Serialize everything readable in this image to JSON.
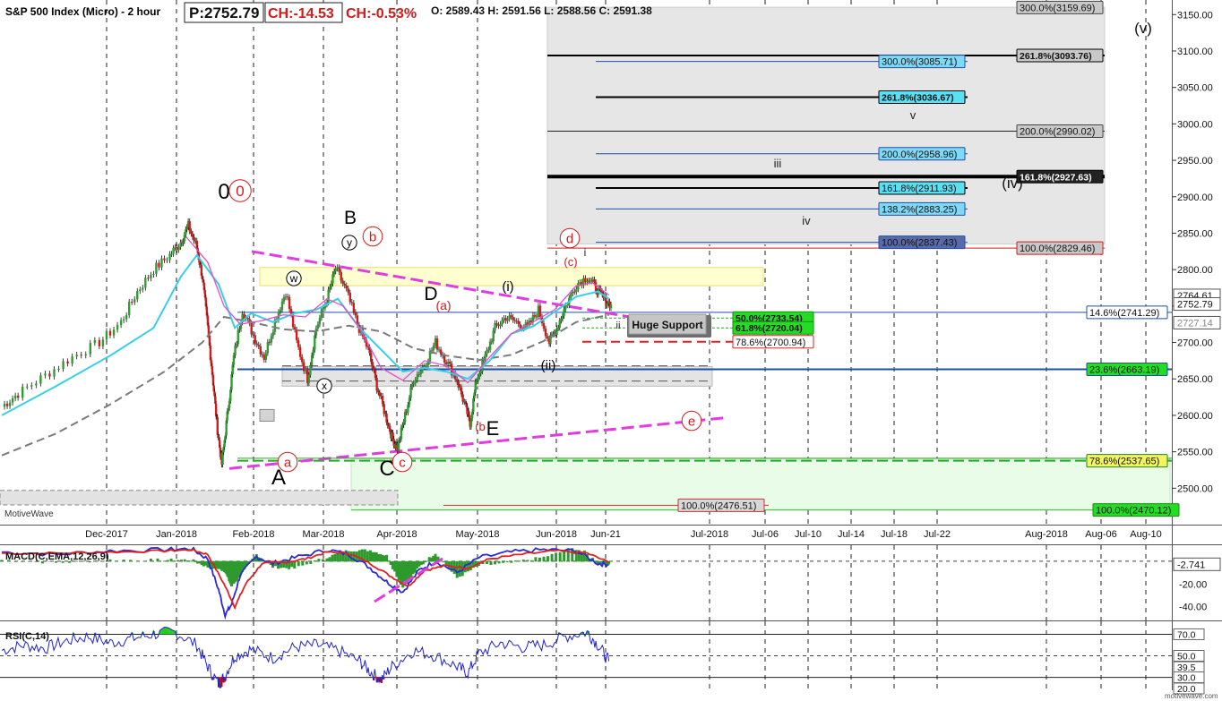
{
  "header": {
    "title": "S&P 500 Index (Micro) - 2 hour",
    "price": "P:2752.79",
    "change": "CH:-14.53",
    "change_pct": "CH:-0.53%",
    "ohlc": "O: 2589.43  H: 2591.56  L: 2588.56  C: 2591.38"
  },
  "watermark": "MotiveWave",
  "footer_site": "motivewave.com",
  "colors": {
    "up": "#2e9e2e",
    "down": "#d21c1c",
    "ma_fast": "#e050c8",
    "ma_mid": "#37cfe8",
    "ma_slow": "#7a7a7a",
    "trendline": "#e03ce0",
    "wave_red": "#d21c1c",
    "fib_blue": "#1d4fa8",
    "macd": "#2a2ad8",
    "signal": "#e22020",
    "hist": "#2e9a2e",
    "rsi": "#2222cc"
  },
  "chart_data": [
    {
      "type": "line",
      "panel": "price",
      "y_axis": {
        "min": 2450,
        "max": 3170,
        "ticks": [
          2500,
          2550,
          2600,
          2650,
          2700,
          2750,
          2800,
          2850,
          2900,
          2950,
          3000,
          3050,
          3100,
          3150
        ],
        "tick_labels": [
          "2500.00",
          "2550.00",
          "2600.00",
          "2650.00",
          "2700.00",
          "2750.00",
          "2800.00",
          "2850.00",
          "2900.00",
          "2950.00",
          "3000.00",
          "3050.00",
          "3100.00",
          "3150.00"
        ]
      },
      "x_axis": {
        "labels": [
          "Dec-2017",
          "Jan-2018",
          "Feb-2018",
          "Mar-2018",
          "Apr-2018",
          "May-2018",
          "Jun-2018",
          "Jun-21",
          "Jul-2018",
          "Jul-06",
          "Jul-10",
          "Jul-14",
          "Jul-18",
          "Jul-22",
          "Aug-2018",
          "Aug-06",
          "Aug-10"
        ]
      },
      "price_path": [
        [
          0,
          2612
        ],
        [
          0.015,
          2630
        ],
        [
          0.04,
          2655
        ],
        [
          0.065,
          2680
        ],
        [
          0.09,
          2700
        ],
        [
          0.11,
          2728
        ],
        [
          0.125,
          2770
        ],
        [
          0.14,
          2800
        ],
        [
          0.155,
          2820
        ],
        [
          0.165,
          2838
        ],
        [
          0.172,
          2860
        ],
        [
          0.18,
          2830
        ],
        [
          0.185,
          2790
        ],
        [
          0.19,
          2720
        ],
        [
          0.195,
          2645
        ],
        [
          0.199,
          2580
        ],
        [
          0.203,
          2533
        ],
        [
          0.208,
          2600
        ],
        [
          0.214,
          2680
        ],
        [
          0.222,
          2745
        ],
        [
          0.232,
          2710
        ],
        [
          0.242,
          2680
        ],
        [
          0.252,
          2730
        ],
        [
          0.262,
          2770
        ],
        [
          0.272,
          2700
        ],
        [
          0.282,
          2650
        ],
        [
          0.29,
          2720
        ],
        [
          0.3,
          2760
        ],
        [
          0.308,
          2802
        ],
        [
          0.318,
          2770
        ],
        [
          0.328,
          2725
        ],
        [
          0.338,
          2690
        ],
        [
          0.346,
          2640
        ],
        [
          0.354,
          2600
        ],
        [
          0.36,
          2570
        ],
        [
          0.365,
          2555
        ],
        [
          0.372,
          2600
        ],
        [
          0.38,
          2650
        ],
        [
          0.39,
          2670
        ],
        [
          0.4,
          2700
        ],
        [
          0.41,
          2675
        ],
        [
          0.42,
          2648
        ],
        [
          0.428,
          2610
        ],
        [
          0.432,
          2590
        ],
        [
          0.438,
          2650
        ],
        [
          0.446,
          2680
        ],
        [
          0.455,
          2720
        ],
        [
          0.465,
          2735
        ],
        [
          0.475,
          2728
        ],
        [
          0.485,
          2720
        ],
        [
          0.495,
          2745
        ],
        [
          0.505,
          2700
        ],
        [
          0.512,
          2720
        ],
        [
          0.52,
          2750
        ],
        [
          0.53,
          2780
        ],
        [
          0.54,
          2790
        ],
        [
          0.548,
          2775
        ],
        [
          0.555,
          2760
        ],
        [
          0.562,
          2752
        ]
      ],
      "ma_fast": [
        [
          0.17,
          2845
        ],
        [
          0.19,
          2810
        ],
        [
          0.205,
          2750
        ],
        [
          0.22,
          2725
        ],
        [
          0.24,
          2730
        ],
        [
          0.26,
          2738
        ],
        [
          0.28,
          2735
        ],
        [
          0.3,
          2760
        ],
        [
          0.315,
          2750
        ],
        [
          0.33,
          2720
        ],
        [
          0.35,
          2665
        ],
        [
          0.37,
          2648
        ],
        [
          0.39,
          2675
        ],
        [
          0.41,
          2668
        ],
        [
          0.43,
          2645
        ],
        [
          0.45,
          2680
        ],
        [
          0.47,
          2712
        ],
        [
          0.49,
          2728
        ],
        [
          0.51,
          2745
        ],
        [
          0.53,
          2778
        ],
        [
          0.545,
          2782
        ],
        [
          0.56,
          2765
        ]
      ],
      "ma_mid": [
        [
          0.0,
          2600
        ],
        [
          0.05,
          2640
        ],
        [
          0.1,
          2682
        ],
        [
          0.14,
          2720
        ],
        [
          0.165,
          2790
        ],
        [
          0.18,
          2820
        ],
        [
          0.2,
          2780
        ],
        [
          0.215,
          2720
        ],
        [
          0.23,
          2740
        ],
        [
          0.25,
          2728
        ],
        [
          0.27,
          2740
        ],
        [
          0.29,
          2745
        ],
        [
          0.31,
          2760
        ],
        [
          0.33,
          2720
        ],
        [
          0.35,
          2690
        ],
        [
          0.37,
          2660
        ],
        [
          0.39,
          2665
        ],
        [
          0.41,
          2660
        ],
        [
          0.43,
          2650
        ],
        [
          0.45,
          2675
        ],
        [
          0.47,
          2712
        ],
        [
          0.49,
          2722
        ],
        [
          0.51,
          2742
        ],
        [
          0.53,
          2763
        ],
        [
          0.55,
          2770
        ],
        [
          0.56,
          2760
        ]
      ],
      "ma_slow": [
        [
          0.0,
          2545
        ],
        [
          0.05,
          2575
        ],
        [
          0.1,
          2615
        ],
        [
          0.15,
          2660
        ],
        [
          0.185,
          2700
        ],
        [
          0.205,
          2735
        ],
        [
          0.23,
          2728
        ],
        [
          0.26,
          2718
        ],
        [
          0.29,
          2715
        ],
        [
          0.32,
          2723
        ],
        [
          0.35,
          2715
        ],
        [
          0.38,
          2692
        ],
        [
          0.41,
          2682
        ],
        [
          0.44,
          2676
        ],
        [
          0.47,
          2683
        ],
        [
          0.5,
          2702
        ],
        [
          0.53,
          2728
        ],
        [
          0.56,
          2738
        ]
      ],
      "fib_levels": [
        {
          "label": "300.0%(3159.69)",
          "value": 3159.69,
          "style": "gray"
        },
        {
          "label": "261.8%(3093.76)",
          "value": 3093.76,
          "style": "gray-bold"
        },
        {
          "label": "300.0%(3085.71)",
          "value": 3085.71,
          "style": "cyan"
        },
        {
          "label": "261.8%(3036.67)",
          "value": 3036.67,
          "style": "cyan-bold"
        },
        {
          "label": "200.0%(2990.02)",
          "value": 2990.02,
          "style": "gray"
        },
        {
          "label": "200.0%(2958.96)",
          "value": 2958.96,
          "style": "cyan"
        },
        {
          "label": "161.8%(2927.63)",
          "value": 2927.63,
          "style": "black-bold"
        },
        {
          "label": "161.8%(2911.93)",
          "value": 2911.93,
          "style": "cyan"
        },
        {
          "label": "138.2%(2883.25)",
          "value": 2883.25,
          "style": "cyan"
        },
        {
          "label": "100.0%(2837.43)",
          "value": 2837.43,
          "style": "navy"
        },
        {
          "label": "100.0%(2829.46)",
          "value": 2829.46,
          "style": "gray-red"
        },
        {
          "label": "14.6%(2741.29)",
          "value": 2741.29,
          "style": "white-blue"
        },
        {
          "label": "50.0%(2733.54)",
          "value": 2733.54,
          "style": "green"
        },
        {
          "label": "61.8%(2720.04)",
          "value": 2720.04,
          "style": "green"
        },
        {
          "label": "78.6%(2700.94)",
          "value": 2700.94,
          "style": "white-red"
        },
        {
          "label": "23.6%(2663.19)",
          "value": 2663.19,
          "style": "green-right"
        },
        {
          "label": "78.6%(2537.65)",
          "value": 2537.65,
          "style": "yellow-right"
        },
        {
          "label": "100.0%(2476.51)",
          "value": 2476.51,
          "style": "gray-red"
        },
        {
          "label": "100.0%(2470.12)",
          "value": 2470.12,
          "style": "green-right"
        }
      ],
      "axis_tags": [
        {
          "label": "2764.61",
          "value": 2764.61
        },
        {
          "label": "2752.79",
          "value": 2752.79
        },
        {
          "label": "2727.14",
          "value": 2727.14
        }
      ],
      "annotations": {
        "support": "Huge Support",
        "waves": [
          "0",
          "0",
          "B",
          "b",
          "y",
          "w",
          "x",
          "A",
          "a",
          "C",
          "c",
          "D",
          "(a)",
          "(i)",
          "(ii)",
          "E",
          "(b",
          "d",
          "(c)",
          "i",
          "ii",
          "e",
          "iii",
          "iv",
          "v",
          "(iv)",
          "(v)"
        ]
      }
    },
    {
      "type": "line",
      "panel": "macd",
      "title": "MACD(C,EMA,12,26,9)",
      "y_axis": {
        "min": -52,
        "max": 14,
        "tick_labels": [
          "-20.00",
          "-40.00"
        ],
        "ticks": [
          -20,
          -40
        ]
      },
      "value_tag": "-2.741",
      "macd": [
        [
          0,
          8
        ],
        [
          0.05,
          6
        ],
        [
          0.1,
          9
        ],
        [
          0.15,
          10
        ],
        [
          0.175,
          11
        ],
        [
          0.19,
          2
        ],
        [
          0.2,
          -25
        ],
        [
          0.206,
          -47
        ],
        [
          0.212,
          -38
        ],
        [
          0.22,
          -12
        ],
        [
          0.235,
          4
        ],
        [
          0.25,
          -2
        ],
        [
          0.27,
          3
        ],
        [
          0.3,
          10
        ],
        [
          0.32,
          6
        ],
        [
          0.34,
          -6
        ],
        [
          0.355,
          -18
        ],
        [
          0.37,
          -27
        ],
        [
          0.385,
          -8
        ],
        [
          0.4,
          0
        ],
        [
          0.42,
          -10
        ],
        [
          0.44,
          3
        ],
        [
          0.47,
          8
        ],
        [
          0.5,
          10
        ],
        [
          0.53,
          9
        ],
        [
          0.55,
          -2
        ],
        [
          0.56,
          -3
        ]
      ],
      "signal": [
        [
          0,
          7
        ],
        [
          0.05,
          7
        ],
        [
          0.1,
          8
        ],
        [
          0.15,
          9
        ],
        [
          0.175,
          10
        ],
        [
          0.19,
          6
        ],
        [
          0.205,
          -20
        ],
        [
          0.215,
          -40
        ],
        [
          0.225,
          -20
        ],
        [
          0.24,
          -2
        ],
        [
          0.26,
          -1
        ],
        [
          0.28,
          2
        ],
        [
          0.3,
          8
        ],
        [
          0.32,
          7
        ],
        [
          0.34,
          -2
        ],
        [
          0.36,
          -14
        ],
        [
          0.375,
          -22
        ],
        [
          0.39,
          -8
        ],
        [
          0.41,
          -4
        ],
        [
          0.43,
          -6
        ],
        [
          0.45,
          2
        ],
        [
          0.48,
          6
        ],
        [
          0.51,
          9
        ],
        [
          0.54,
          7
        ],
        [
          0.56,
          -1
        ]
      ]
    },
    {
      "type": "line",
      "panel": "rsi",
      "title": "RSI(C,14)",
      "y_axis": {
        "min": 18,
        "max": 82,
        "ticks": [
          70,
          50,
          39.5,
          30
        ],
        "tick_labels": [
          "70.0",
          "50.0",
          "39.5",
          "30.0",
          "20.0"
        ]
      },
      "rsi": [
        [
          0,
          55
        ],
        [
          0.02,
          60
        ],
        [
          0.04,
          57
        ],
        [
          0.06,
          64
        ],
        [
          0.08,
          68
        ],
        [
          0.1,
          62
        ],
        [
          0.12,
          66
        ],
        [
          0.14,
          70
        ],
        [
          0.16,
          72
        ],
        [
          0.18,
          60
        ],
        [
          0.19,
          40
        ],
        [
          0.2,
          24
        ],
        [
          0.205,
          30
        ],
        [
          0.215,
          50
        ],
        [
          0.23,
          56
        ],
        [
          0.25,
          48
        ],
        [
          0.27,
          58
        ],
        [
          0.29,
          60
        ],
        [
          0.31,
          55
        ],
        [
          0.33,
          45
        ],
        [
          0.34,
          35
        ],
        [
          0.35,
          28
        ],
        [
          0.36,
          40
        ],
        [
          0.38,
          55
        ],
        [
          0.4,
          50
        ],
        [
          0.42,
          40
        ],
        [
          0.43,
          34
        ],
        [
          0.44,
          52
        ],
        [
          0.46,
          62
        ],
        [
          0.48,
          58
        ],
        [
          0.5,
          60
        ],
        [
          0.52,
          68
        ],
        [
          0.54,
          72
        ],
        [
          0.55,
          60
        ],
        [
          0.56,
          45
        ]
      ]
    }
  ]
}
